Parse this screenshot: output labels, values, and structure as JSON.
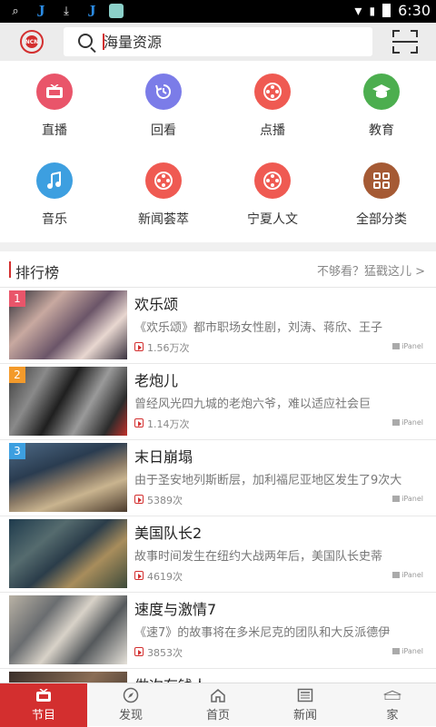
{
  "status_bar": {
    "time": "6:30"
  },
  "search": {
    "placeholder": "海量资源"
  },
  "categories": [
    {
      "label": "直播",
      "color": "#e9556a",
      "icon": "tv-icon"
    },
    {
      "label": "回看",
      "color": "#7b7ce8",
      "icon": "replay-icon"
    },
    {
      "label": "点播",
      "color": "#ef5a52",
      "icon": "film-reel-icon"
    },
    {
      "label": "教育",
      "color": "#4cae4f",
      "icon": "graduation-cap-icon"
    },
    {
      "label": "音乐",
      "color": "#3d9fe0",
      "icon": "music-note-icon"
    },
    {
      "label": "新闻荟萃",
      "color": "#ef5a52",
      "icon": "film-reel-icon"
    },
    {
      "label": "宁夏人文",
      "color": "#ef5a52",
      "icon": "film-reel-icon"
    },
    {
      "label": "全部分类",
      "color": "#a55a34",
      "icon": "grid-icon"
    }
  ],
  "ranking": {
    "title": "排行榜",
    "more": "不够看？猛戳这儿 >",
    "items": [
      {
        "rank": "1",
        "badge_color": "#e9556a",
        "title": "欢乐颂",
        "desc": "《欢乐颂》都市职场女性剧，刘涛、蒋欣、王子",
        "views": "1.56万次",
        "source": "iPanel"
      },
      {
        "rank": "2",
        "badge_color": "#f39a2b",
        "title": "老炮儿",
        "desc": "曾经风光四九城的老炮六爷，难以适应社会巨",
        "views": "1.14万次",
        "source": "iPanel"
      },
      {
        "rank": "3",
        "badge_color": "#3d9fe0",
        "title": "末日崩塌",
        "desc": "由于圣安地列斯断层，加利福尼亚地区发生了9次大",
        "views": "5389次",
        "source": "iPanel"
      },
      {
        "rank": "",
        "badge_color": "",
        "title": "美国队长2",
        "desc": "故事时间发生在纽约大战两年后，美国队长史蒂",
        "views": "4619次",
        "source": "iPanel"
      },
      {
        "rank": "",
        "badge_color": "",
        "title": "速度与激情7",
        "desc": "《速7》的故事将在多米尼克的团队和大反派德伊",
        "views": "3853次",
        "source": "iPanel"
      },
      {
        "rank": "",
        "badge_color": "",
        "title": "做次有钱人",
        "desc": "",
        "views": "",
        "source": ""
      }
    ]
  },
  "tabs": [
    {
      "label": "节目",
      "icon": "tv-icon",
      "active": true
    },
    {
      "label": "发现",
      "icon": "compass-icon",
      "active": false
    },
    {
      "label": "首页",
      "icon": "home-icon",
      "active": false
    },
    {
      "label": "新闻",
      "icon": "news-icon",
      "active": false
    },
    {
      "label": "家",
      "icon": "homed-icon",
      "active": false
    }
  ],
  "theme": {
    "accent": "#d32f2f"
  }
}
